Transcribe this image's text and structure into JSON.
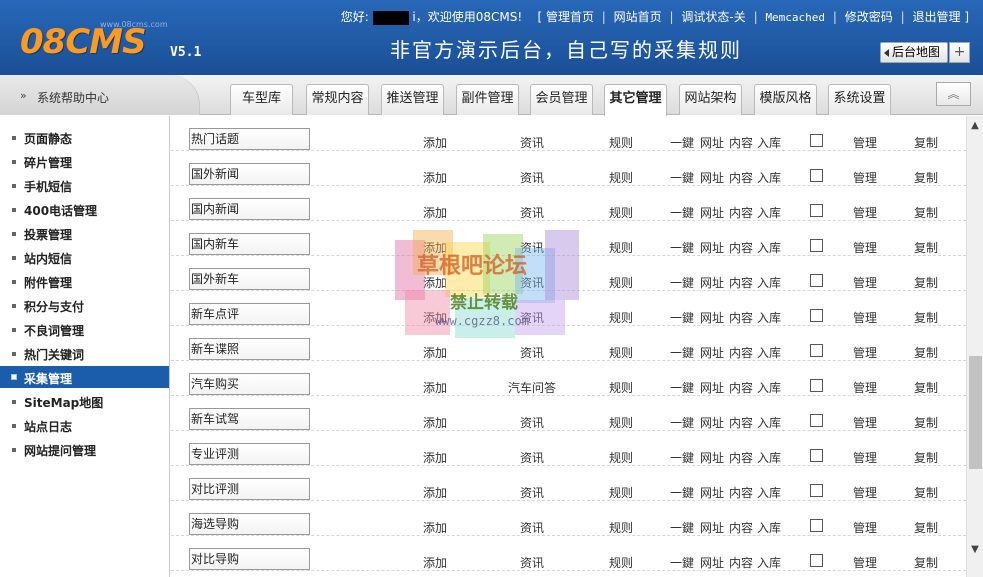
{
  "app": {
    "logo": "08CMS",
    "logo_sub": "www.08cms.com",
    "version": "V5.1",
    "slogan": "非官方演示后台，自己写的采集规则"
  },
  "topbar": {
    "greeting_prefix": "您好:",
    "greeting_suffix": "i，欢迎使用08CMS!",
    "bracket_open": "[",
    "links": [
      "管理首页",
      "网站首页",
      "调试状态-关",
      "Memcached",
      "修改密码",
      "退出管理"
    ],
    "bracket_close": "]"
  },
  "header_buttons": {
    "sitemap": "后台地图",
    "plus": "+"
  },
  "navbar": {
    "help_label": "系统帮助中心",
    "help_icon": "double-chevron-right-icon",
    "collapse_icon": "double-chevron-up-icon",
    "tabs": [
      {
        "label": "车型库",
        "active": false
      },
      {
        "label": "常规内容",
        "active": false
      },
      {
        "label": "推送管理",
        "active": false
      },
      {
        "label": "副件管理",
        "active": false
      },
      {
        "label": "会员管理",
        "active": false
      },
      {
        "label": "其它管理",
        "active": true
      },
      {
        "label": "网站架构",
        "active": false
      },
      {
        "label": "模版风格",
        "active": false
      },
      {
        "label": "系统设置",
        "active": false
      }
    ]
  },
  "sidebar": {
    "items": [
      {
        "label": "页面静态",
        "active": false
      },
      {
        "label": "碎片管理",
        "active": false
      },
      {
        "label": "手机短信",
        "active": false
      },
      {
        "label": "400电话管理",
        "active": false
      },
      {
        "label": "投票管理",
        "active": false
      },
      {
        "label": "站内短信",
        "active": false
      },
      {
        "label": "附件管理",
        "active": false
      },
      {
        "label": "积分与支付",
        "active": false
      },
      {
        "label": "不良词管理",
        "active": false
      },
      {
        "label": "热门关键词",
        "active": false
      },
      {
        "label": "采集管理",
        "active": true
      },
      {
        "label": "SiteMap地图",
        "active": false
      },
      {
        "label": "站点日志",
        "active": false
      },
      {
        "label": "网站提问管理",
        "active": false
      }
    ]
  },
  "table": {
    "rows": [
      {
        "name": "热门话题",
        "add": "添加",
        "channel": "资讯",
        "rule": "规则",
        "onekey": "一鍵",
        "url": "网址",
        "content": "内容",
        "store": "入库",
        "checked": false,
        "manage": "管理",
        "copy": "复制"
      },
      {
        "name": "国外新闻",
        "add": "添加",
        "channel": "资讯",
        "rule": "规则",
        "onekey": "一鍵",
        "url": "网址",
        "content": "内容",
        "store": "入库",
        "checked": false,
        "manage": "管理",
        "copy": "复制"
      },
      {
        "name": "国内新闻",
        "add": "添加",
        "channel": "资讯",
        "rule": "规则",
        "onekey": "一鍵",
        "url": "网址",
        "content": "内容",
        "store": "入库",
        "checked": false,
        "manage": "管理",
        "copy": "复制"
      },
      {
        "name": "国内新车",
        "add": "添加",
        "channel": "资讯",
        "rule": "规则",
        "onekey": "一鍵",
        "url": "网址",
        "content": "内容",
        "store": "入库",
        "checked": false,
        "manage": "管理",
        "copy": "复制"
      },
      {
        "name": "国外新车",
        "add": "添加",
        "channel": "资讯",
        "rule": "规则",
        "onekey": "一鍵",
        "url": "网址",
        "content": "内容",
        "store": "入库",
        "checked": false,
        "manage": "管理",
        "copy": "复制"
      },
      {
        "name": "新车点评",
        "add": "添加",
        "channel": "资讯",
        "rule": "规则",
        "onekey": "一鍵",
        "url": "网址",
        "content": "内容",
        "store": "入库",
        "checked": false,
        "manage": "管理",
        "copy": "复制"
      },
      {
        "name": "新车谍照",
        "add": "添加",
        "channel": "资讯",
        "rule": "规则",
        "onekey": "一鍵",
        "url": "网址",
        "content": "内容",
        "store": "入库",
        "checked": false,
        "manage": "管理",
        "copy": "复制"
      },
      {
        "name": "汽车购买",
        "add": "添加",
        "channel": "汽车问答",
        "rule": "规则",
        "onekey": "一鍵",
        "url": "网址",
        "content": "内容",
        "store": "入库",
        "checked": false,
        "manage": "管理",
        "copy": "复制"
      },
      {
        "name": "新车试驾",
        "add": "添加",
        "channel": "资讯",
        "rule": "规则",
        "onekey": "一鍵",
        "url": "网址",
        "content": "内容",
        "store": "入库",
        "checked": false,
        "manage": "管理",
        "copy": "复制"
      },
      {
        "name": "专业评测",
        "add": "添加",
        "channel": "资讯",
        "rule": "规则",
        "onekey": "一鍵",
        "url": "网址",
        "content": "内容",
        "store": "入库",
        "checked": false,
        "manage": "管理",
        "copy": "复制"
      },
      {
        "name": "对比评测",
        "add": "添加",
        "channel": "资讯",
        "rule": "规则",
        "onekey": "一鍵",
        "url": "网址",
        "content": "内容",
        "store": "入库",
        "checked": false,
        "manage": "管理",
        "copy": "复制"
      },
      {
        "name": "海选导购",
        "add": "添加",
        "channel": "资讯",
        "rule": "规则",
        "onekey": "一鍵",
        "url": "网址",
        "content": "内容",
        "store": "入库",
        "checked": false,
        "manage": "管理",
        "copy": "复制"
      },
      {
        "name": "对比导购",
        "add": "添加",
        "channel": "资讯",
        "rule": "规则",
        "onekey": "一鍵",
        "url": "网址",
        "content": "内容",
        "store": "入库",
        "checked": false,
        "manage": "管理",
        "copy": "复制"
      }
    ]
  },
  "watermark": {
    "line1": "草根吧论坛",
    "line2": "禁止转载",
    "line3": "www.cgzz8.com"
  },
  "colors": {
    "header_bg": "#1a5aa8",
    "logo": "#ff9a1e",
    "sidebar_active": "#1b5daa"
  }
}
